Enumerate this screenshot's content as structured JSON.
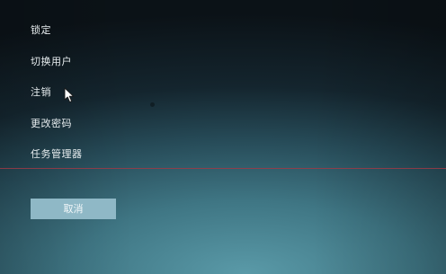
{
  "menu": {
    "items": [
      {
        "name": "lock",
        "label": "锁定"
      },
      {
        "name": "switch-user",
        "label": "切换用户"
      },
      {
        "name": "sign-out",
        "label": "注销"
      },
      {
        "name": "change-password",
        "label": "更改密码"
      },
      {
        "name": "task-manager",
        "label": "任务管理器"
      }
    ]
  },
  "cancel_button": {
    "label": "取消"
  },
  "colors": {
    "divider": "#9c3a45",
    "button_bg": "#8fb8c6",
    "text": "#e8eef0"
  },
  "icons": {
    "cursor": "arrow-cursor-icon"
  }
}
